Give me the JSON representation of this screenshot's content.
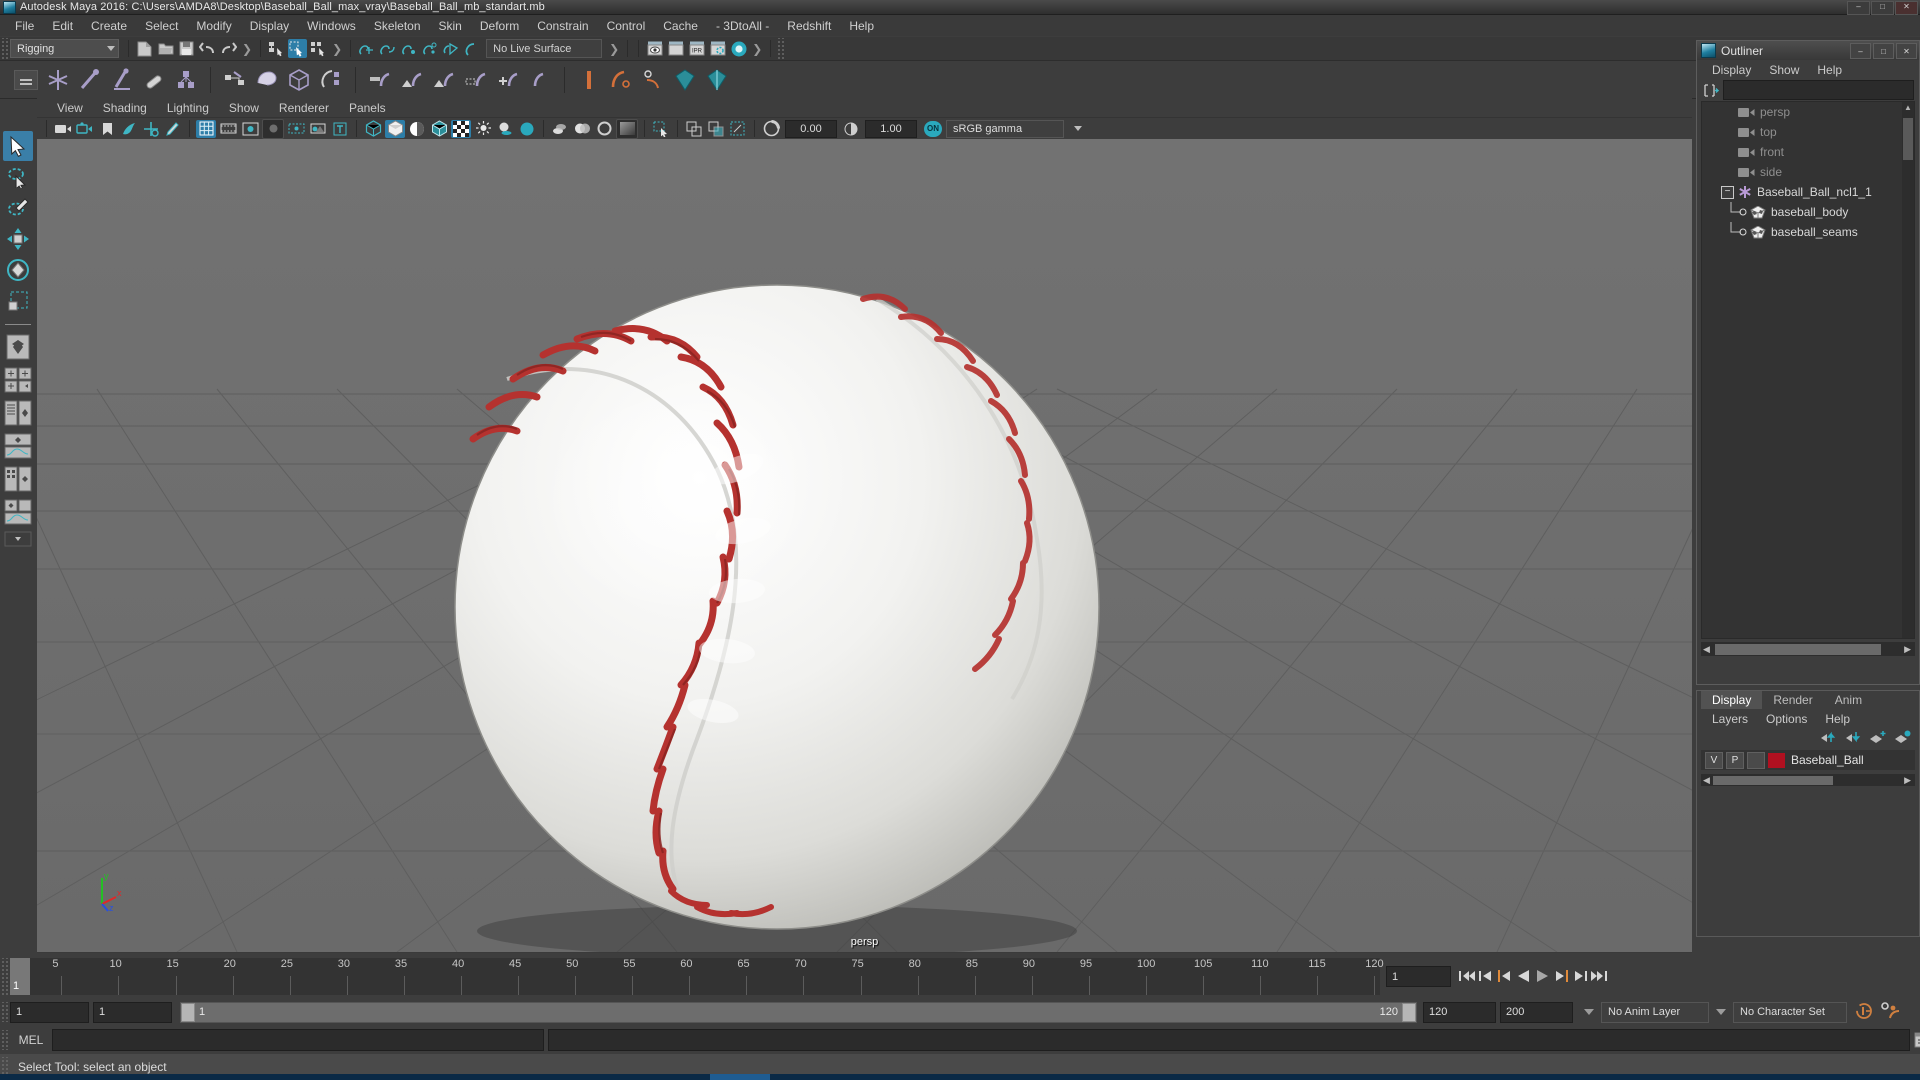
{
  "window": {
    "title": "Autodesk Maya 2016: C:\\Users\\AMDA8\\Desktop\\Baseball_Ball_max_vray\\Baseball_Ball_mb_standart.mb",
    "icon": "maya-app-icon",
    "buttons": {
      "minimize": "–",
      "maximize": "□",
      "close": "✕"
    }
  },
  "main_menu": {
    "items": [
      {
        "label": "File"
      },
      {
        "label": "Edit"
      },
      {
        "label": "Create"
      },
      {
        "label": "Select"
      },
      {
        "label": "Modify"
      },
      {
        "label": "Display"
      },
      {
        "label": "Windows"
      },
      {
        "label": "Skeleton"
      },
      {
        "label": "Skin"
      },
      {
        "label": "Deform"
      },
      {
        "label": "Constrain"
      },
      {
        "label": "Control"
      },
      {
        "label": "Cache"
      },
      {
        "label": "- 3DtoAll -"
      },
      {
        "label": "Redshift"
      },
      {
        "label": "Help"
      }
    ]
  },
  "status_toolbar": {
    "menu_set": "Rigging",
    "live_surface": "No Live Surface",
    "icons": [
      "new-scene-icon",
      "open-scene-icon",
      "save-scene-icon",
      "undo-icon",
      "redo-icon",
      "select-by-hierarchy-icon",
      "select-by-object-icon",
      "select-by-component-icon",
      "snap-to-grid-icon",
      "snap-to-curve-icon",
      "snap-to-point-icon",
      "snap-to-projected-center-icon",
      "snap-to-view-plane-icon",
      "make-live-icon",
      "render-view-icon",
      "render-current-frame-icon",
      "ipr-render-icon",
      "render-settings-icon",
      "hypershade-icon"
    ],
    "ipr_label": "IPR"
  },
  "shelf": {
    "handle": "shelf-handle-icon",
    "icons": [
      "joint-tool-icon",
      "ik-handle-tool-icon",
      "ik-spline-handle-icon",
      "insert-joint-tool-icon",
      "mirror-joint-icon",
      "connect-joint-icon",
      "bind-skin-icon",
      "lattice-icon",
      "flexor-icon",
      "smooth-bind-icon",
      "interactive-bind-icon",
      "detach-skin-icon",
      "paint-weights-icon",
      "copy-weights-icon",
      "mirror-weights-icon",
      "cluster-icon",
      "soft-modifier-icon",
      "blend-shape-icon",
      "wrap-icon",
      "wire-tool-icon"
    ]
  },
  "toolbox": {
    "items": [
      {
        "name": "select-tool",
        "selected": true
      },
      {
        "name": "lasso-tool",
        "selected": false
      },
      {
        "name": "paint-select-tool",
        "selected": false
      },
      {
        "name": "move-tool",
        "selected": false
      },
      {
        "name": "rotate-tool",
        "selected": false
      },
      {
        "name": "scale-tool",
        "selected": false
      }
    ],
    "layout_items": [
      "single-perspective-layout",
      "four-view-layout",
      "outliner-persp-layout",
      "persp-graph-layout",
      "hypershade-persp-layout",
      "persp-graph-outliner-layout"
    ]
  },
  "viewport": {
    "menu": [
      {
        "label": "View"
      },
      {
        "label": "Shading"
      },
      {
        "label": "Lighting"
      },
      {
        "label": "Show"
      },
      {
        "label": "Renderer"
      },
      {
        "label": "Panels"
      }
    ],
    "toolbar_icons": [
      "select-camera-icon",
      "camera-attributes-icon",
      "bookmark-icon",
      "image-plane-icon",
      "2d-pan-zoom-icon",
      "oil-paint-icon",
      "grid-toggle-icon",
      "film-gate-icon",
      "resolution-gate-icon",
      "gate-mask-icon",
      "film-origin-icon",
      "exposure-icon",
      "text-overlay-icon",
      "wireframe-shading-icon",
      "smooth-shade-all-icon",
      "shade-flat-icon",
      "wireframe-on-shaded-icon",
      "texture-toggle-icon",
      "lighting-toggle-icon",
      "shadows-icon",
      "screen-space-ao-icon",
      "motion-blur-icon",
      "multisample-icon",
      "xray-icon",
      "xray-joints-icon",
      "xray-active-icon",
      "isolate-select-icon",
      "mask-display-icon",
      "snapshot-icon"
    ],
    "exposure": "0.00",
    "gamma": "1.00",
    "gamma_toggle": "ON",
    "color_space": "sRGB gamma",
    "label": "persp",
    "axis": {
      "x": "x",
      "y": "y",
      "z": "z"
    }
  },
  "outliner": {
    "title": "Outliner",
    "window_buttons": {
      "minimize": "–",
      "maximize": "□",
      "close": "✕"
    },
    "menu": [
      {
        "label": "Display"
      },
      {
        "label": "Show"
      },
      {
        "label": "Help"
      }
    ],
    "search_value": "",
    "search_placeholder": "",
    "items": [
      {
        "label": "persp",
        "type": "camera",
        "indent": 2,
        "dim": true
      },
      {
        "label": "top",
        "type": "camera",
        "indent": 2,
        "dim": true
      },
      {
        "label": "front",
        "type": "camera",
        "indent": 2,
        "dim": true
      },
      {
        "label": "side",
        "type": "camera",
        "indent": 2,
        "dim": true
      },
      {
        "label": "Baseball_Ball_ncl1_1",
        "type": "group",
        "indent": 1,
        "dim": false,
        "expander": "−"
      },
      {
        "label": "baseball_body",
        "type": "mesh",
        "indent": 3,
        "dim": false
      },
      {
        "label": "baseball_seams",
        "type": "mesh",
        "indent": 3,
        "dim": false
      }
    ]
  },
  "layer_editor": {
    "tabs": [
      {
        "label": "Display",
        "active": true
      },
      {
        "label": "Render",
        "active": false
      },
      {
        "label": "Anim",
        "active": false
      }
    ],
    "menu": [
      {
        "label": "Layers"
      },
      {
        "label": "Options"
      },
      {
        "label": "Help"
      }
    ],
    "buttons": [
      "move-layer-up-icon",
      "move-layer-down-icon",
      "new-layer-icon",
      "new-layer-from-selected-icon"
    ],
    "layers": [
      {
        "visible": "V",
        "playback": "P",
        "state": "",
        "color": "#b01020",
        "name": "Baseball_Ball"
      }
    ]
  },
  "time_slider": {
    "current_frame": "1",
    "start": 1,
    "end": 120,
    "ticks": [
      5,
      10,
      15,
      20,
      25,
      30,
      35,
      40,
      45,
      50,
      55,
      60,
      65,
      70,
      75,
      80,
      85,
      90,
      95,
      100,
      105,
      110,
      115,
      120
    ],
    "frame_field": "1",
    "playback_buttons": [
      "go-to-start-icon",
      "step-back-keyframe-icon",
      "step-back-frame-icon",
      "play-backwards-icon",
      "play-forwards-icon",
      "step-forward-frame-icon",
      "step-forward-keyframe-icon",
      "go-to-end-icon"
    ]
  },
  "range_slider": {
    "anim_start": "1",
    "playback_start": "1",
    "range_start_label": "1",
    "range_end_label": "120",
    "playback_end": "120",
    "anim_end": "200",
    "anim_layer": "No Anim Layer",
    "character_set": "No Character Set",
    "auto_key_icon": "auto-keyframe-icon",
    "anim_prefs_icon": "animation-preferences-icon"
  },
  "command_line": {
    "language": "MEL",
    "input_value": "",
    "output_value": "",
    "script_editor_icon": "script-editor-icon"
  },
  "status_line": {
    "message": "Select Tool: select an object"
  },
  "colors": {
    "accent_blue": "#2d7ea8",
    "teal": "#3fb6c4",
    "panel_bg": "#3d3d3d",
    "viewport_bg": "#6e6e6e",
    "layer_color": "#b01020",
    "orange": "#d07a3a"
  }
}
